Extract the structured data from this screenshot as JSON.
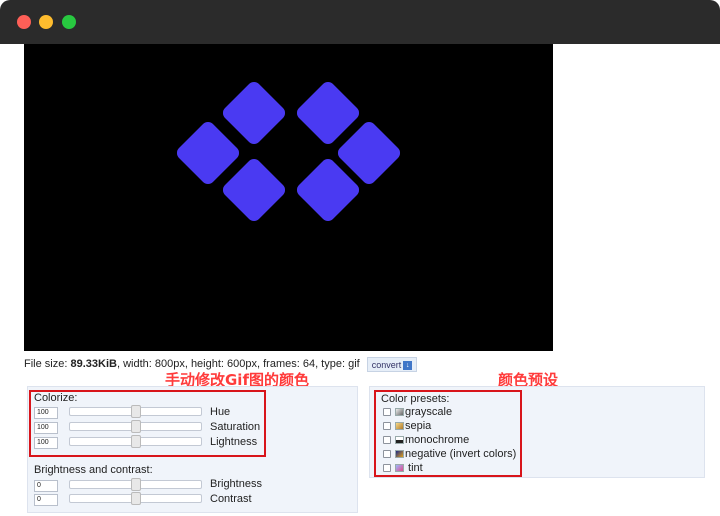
{
  "window": {
    "traffic_lights": [
      "close",
      "minimize",
      "zoom"
    ],
    "colors": {
      "close": "#fe5f57",
      "minimize": "#febc2e",
      "zoom": "#28c840"
    }
  },
  "preview": {
    "background": "#000000",
    "gradient_start": "#4a3af2",
    "gradient_end": "#ff1f7a"
  },
  "file_info": {
    "prefix": "File size: ",
    "size": "89.33KiB",
    "details": ", width: 800px, height: 600px, frames: 64, type: gif",
    "convert_label": "convert"
  },
  "annotations": {
    "left": "手动修改Gif图的颜色",
    "right": "颜色预设",
    "color": "#ff3b3b"
  },
  "colorize": {
    "title": "Colorize:",
    "rows": [
      {
        "value": "100",
        "label": "Hue",
        "level": 0.5
      },
      {
        "value": "100",
        "label": "Saturation",
        "level": 0.5
      },
      {
        "value": "100",
        "label": "Lightness",
        "level": 0.5
      }
    ]
  },
  "brightness_contrast": {
    "title": "Brightness and contrast:",
    "rows": [
      {
        "value": "0",
        "label": "Brightness",
        "level": 0.5
      },
      {
        "value": "0",
        "label": "Contrast",
        "level": 0.5
      }
    ]
  },
  "presets": {
    "title": "Color presets:",
    "items": [
      {
        "label": "grayscale",
        "icon": "grayscale-icon"
      },
      {
        "label": "sepia",
        "icon": "sepia-icon"
      },
      {
        "label": "monochrome",
        "icon": "monochrome-icon"
      },
      {
        "label": "negative (invert colors)",
        "icon": "negative-icon"
      },
      {
        "label": " tint",
        "icon": "tint-icon"
      }
    ]
  }
}
